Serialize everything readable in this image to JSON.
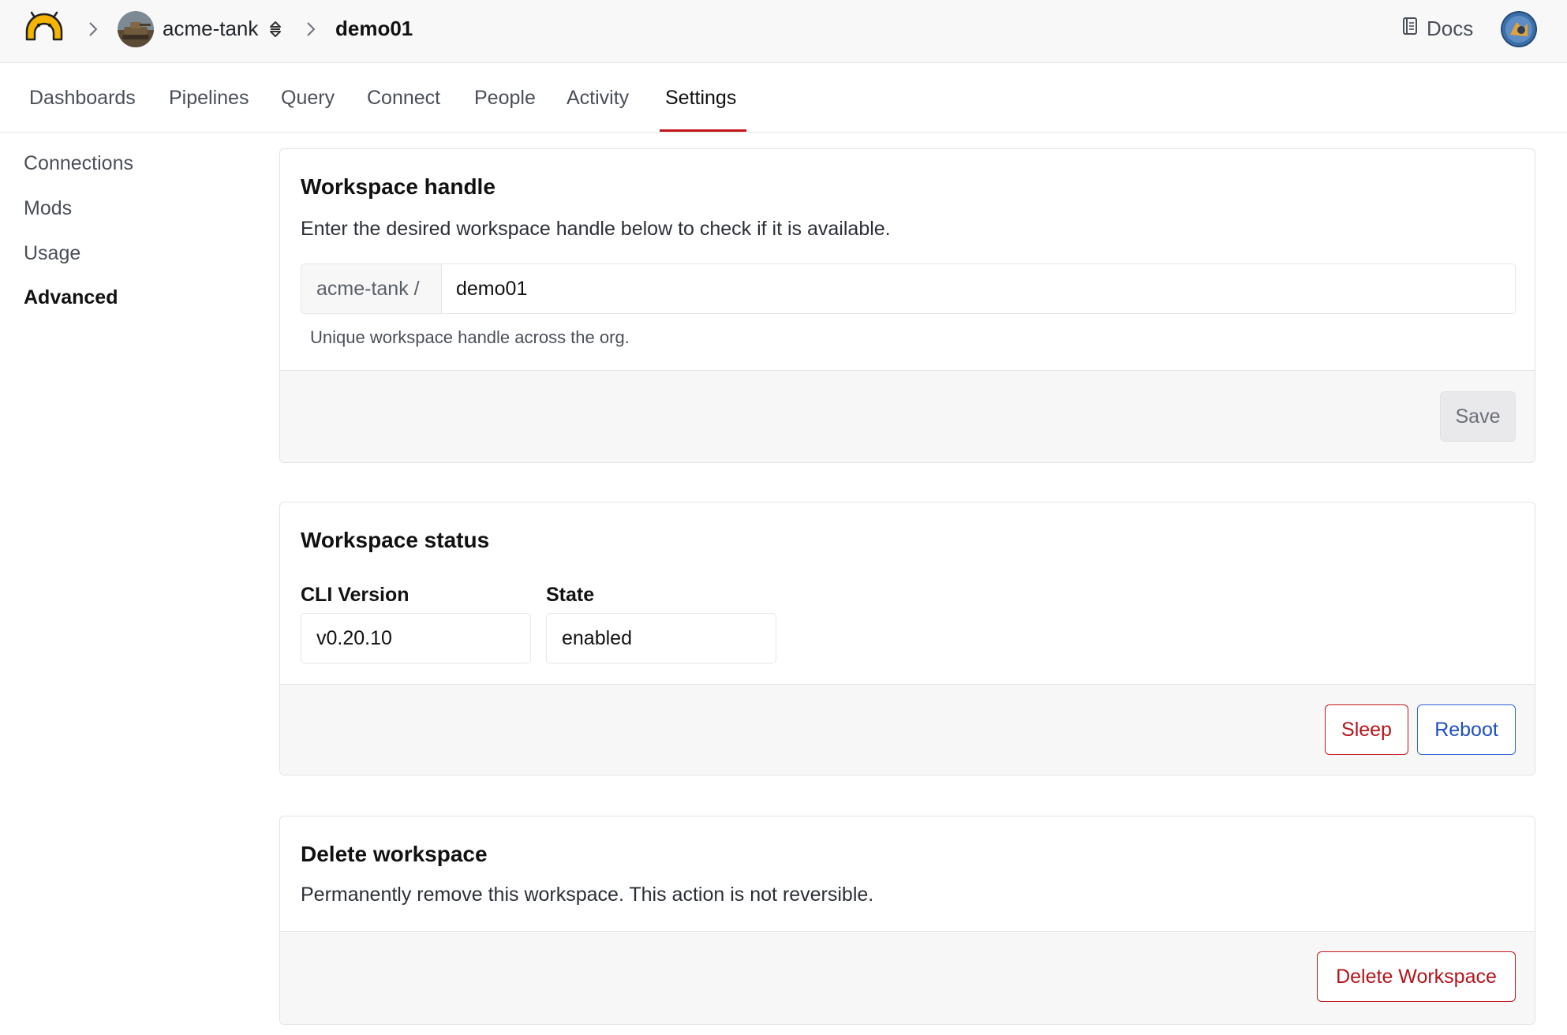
{
  "header": {
    "org_name": "acme-tank",
    "workspace_name": "demo01",
    "docs_label": "Docs"
  },
  "tabs": [
    {
      "label": "Dashboards"
    },
    {
      "label": "Pipelines"
    },
    {
      "label": "Query"
    },
    {
      "label": "Connect"
    },
    {
      "label": "People"
    },
    {
      "label": "Activity"
    },
    {
      "label": "Settings",
      "active": true
    }
  ],
  "sidebar": {
    "items": [
      {
        "label": "Connections"
      },
      {
        "label": "Mods"
      },
      {
        "label": "Usage"
      },
      {
        "label": "Advanced",
        "active": true
      }
    ]
  },
  "handle_card": {
    "title": "Workspace handle",
    "description": "Enter the desired workspace handle below to check if it is available.",
    "prefix": "acme-tank /",
    "value": "demo01",
    "hint": "Unique workspace handle across the org.",
    "save_label": "Save"
  },
  "status_card": {
    "title": "Workspace status",
    "cli_label": "CLI Version",
    "cli_value": "v0.20.10",
    "state_label": "State",
    "state_value": "enabled",
    "sleep_label": "Sleep",
    "reboot_label": "Reboot"
  },
  "delete_card": {
    "title": "Delete workspace",
    "description": "Permanently remove this workspace. This action is not reversible.",
    "delete_label": "Delete Workspace"
  },
  "colors": {
    "accent": "#c4161c",
    "primary": "#2f62d6",
    "logo": "#f5b400"
  }
}
